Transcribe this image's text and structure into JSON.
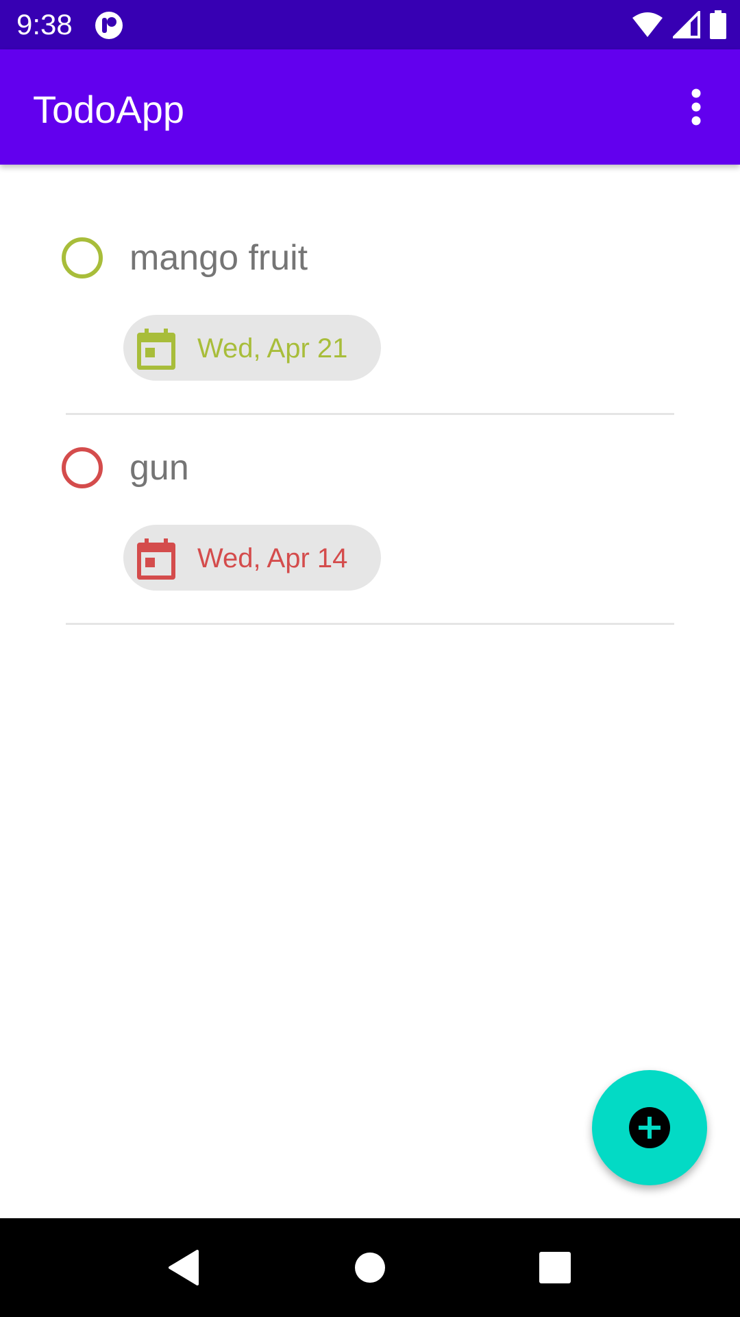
{
  "status_bar": {
    "time": "9:38"
  },
  "app_bar": {
    "title": "TodoApp"
  },
  "todos": [
    {
      "title": "mango fruit",
      "due_label": "Wed, Apr 21",
      "color": "#a8bd3a"
    },
    {
      "title": "gun",
      "due_label": "Wed, Apr 14",
      "color": "#d44c4c"
    }
  ],
  "icons": {
    "overflow": "more-vert-icon",
    "fab": "add-circle-icon",
    "date": "calendar-icon"
  },
  "colors": {
    "status_bar": "#3700b3",
    "app_bar": "#6200ee",
    "fab": "#03dac5"
  }
}
